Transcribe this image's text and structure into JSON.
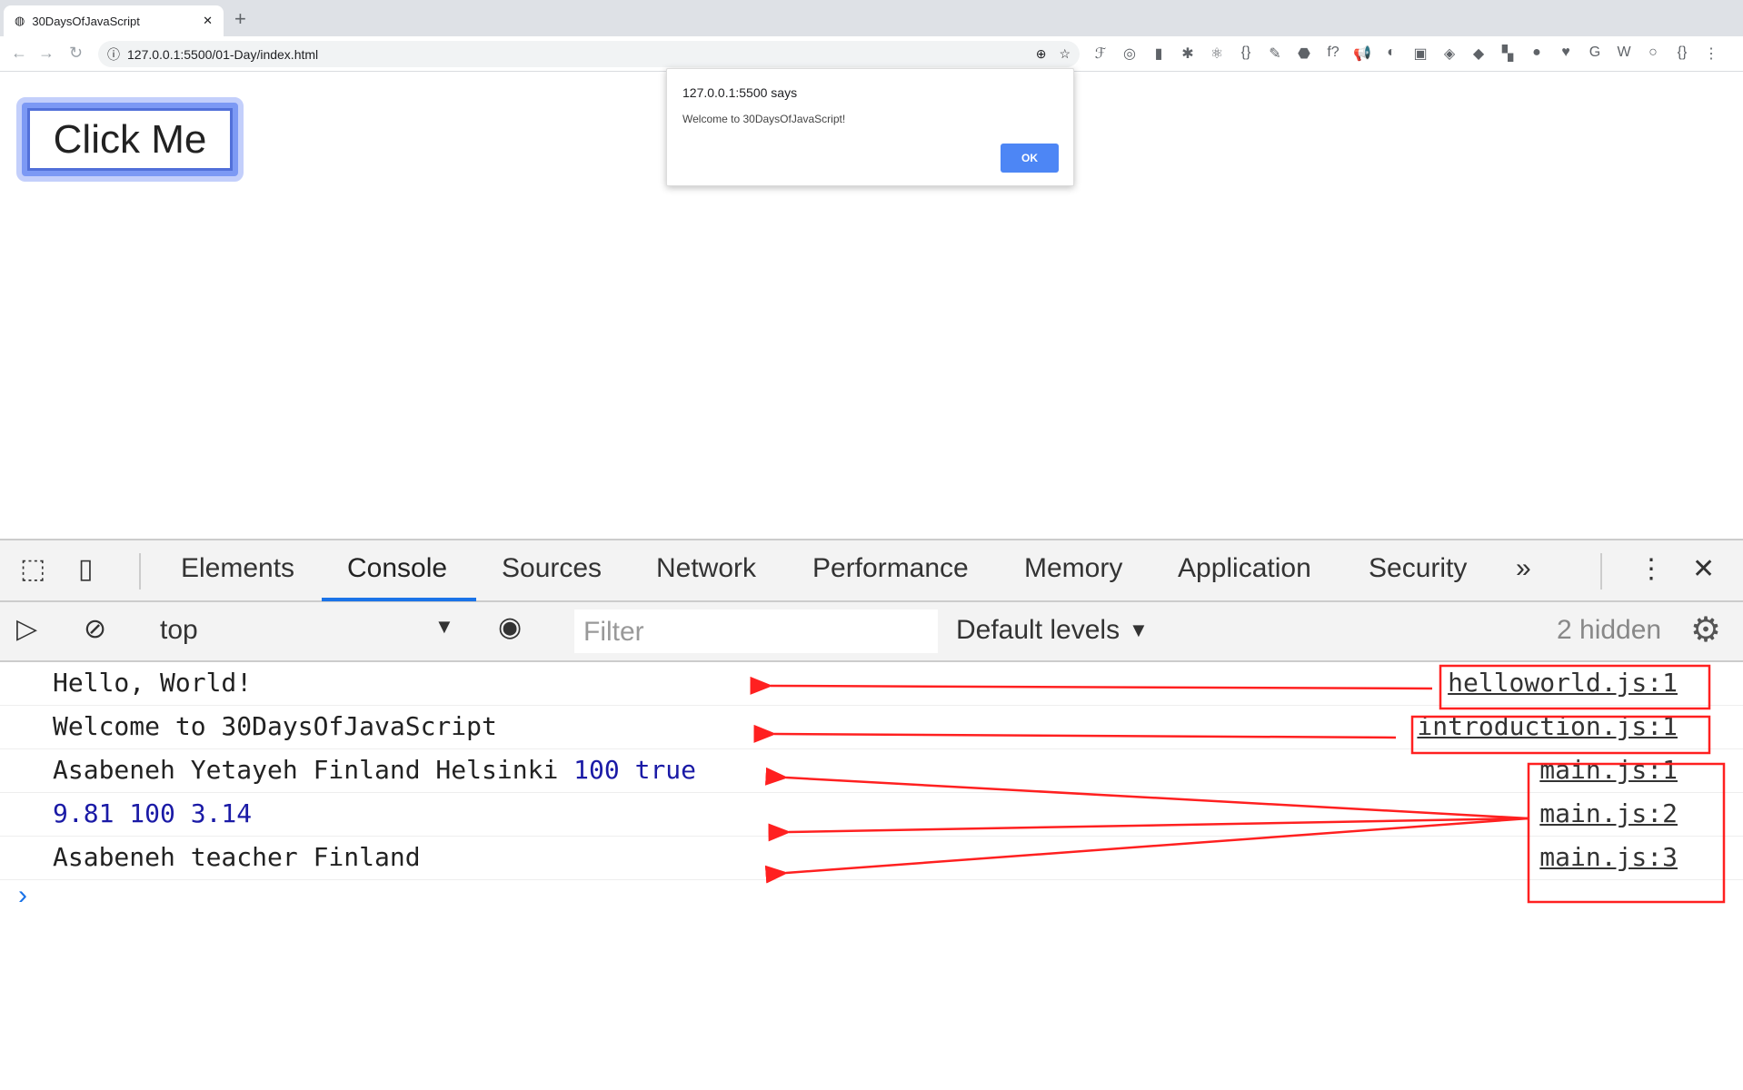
{
  "browser": {
    "tab_title": "30DaysOfJavaScript",
    "url": "127.0.0.1:5500/01-Day/index.html",
    "extension_icons": [
      "fontface",
      "target",
      "bars",
      "bug",
      "react",
      "braces",
      "eyedropper",
      "stop",
      "f?",
      "megaphone",
      "circle",
      "camera",
      "graphql",
      "apollo",
      "pin",
      "bookmark",
      "heart-search",
      "g",
      "w",
      "ring",
      "json"
    ]
  },
  "page": {
    "button_label": "Click Me"
  },
  "dialog": {
    "title": "127.0.0.1:5500 says",
    "message": "Welcome to 30DaysOfJavaScript!",
    "ok_label": "OK"
  },
  "devtools": {
    "tabs": [
      "Elements",
      "Console",
      "Sources",
      "Network",
      "Performance",
      "Memory",
      "Application",
      "Security"
    ],
    "active_tab": "Console",
    "context": "top",
    "filter_placeholder": "Filter",
    "levels": "Default levels",
    "hidden": "2 hidden",
    "console": [
      {
        "parts": [
          {
            "t": "Hello, World!",
            "c": ""
          }
        ],
        "source": "helloworld.js:1"
      },
      {
        "parts": [
          {
            "t": "Welcome to 30DaysOfJavaScript",
            "c": ""
          }
        ],
        "source": "introduction.js:1"
      },
      {
        "parts": [
          {
            "t": "Asabeneh Yetayeh Finland Helsinki ",
            "c": ""
          },
          {
            "t": "100 true",
            "c": "num"
          }
        ],
        "source": "main.js:1"
      },
      {
        "parts": [
          {
            "t": "9.81 100 3.14",
            "c": "num"
          }
        ],
        "source": "main.js:2"
      },
      {
        "parts": [
          {
            "t": "Asabeneh teacher Finland",
            "c": ""
          }
        ],
        "source": "main.js:3"
      }
    ]
  },
  "colors": {
    "annotation": "#ff2020",
    "accent": "#1a73e8",
    "number": "#1a1aa6"
  }
}
